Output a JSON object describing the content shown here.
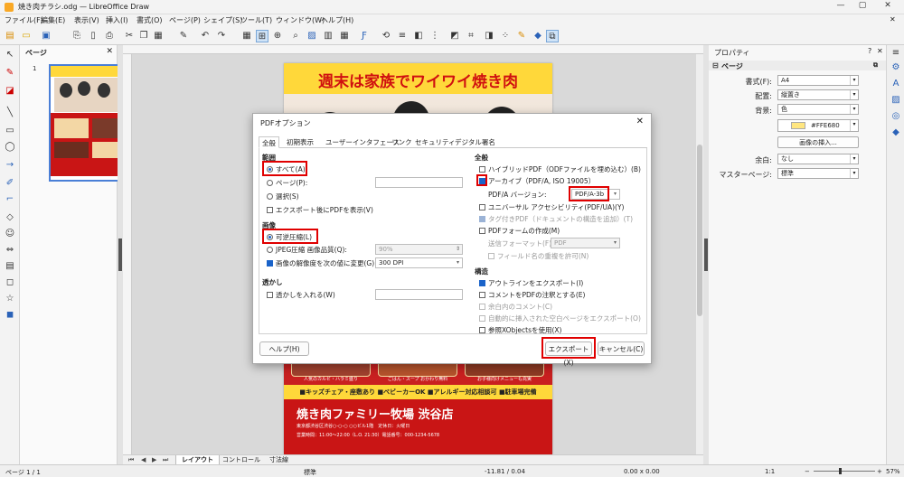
{
  "window": {
    "title": "焼き肉チラシ.odg — LibreOffice Draw"
  },
  "menu": [
    "ファイル(F)",
    "編集(E)",
    "表示(V)",
    "挿入(I)",
    "書式(O)",
    "ページ(P)",
    "シェイプ(S)",
    "ツール(T)",
    "ウィンドウ(W)",
    "ヘルプ(H)"
  ],
  "pages_panel": {
    "title": "ページ",
    "thumb_number": "1"
  },
  "flyer": {
    "headline": "週末は家族でワイワイ焼き肉",
    "food_captions": [
      "人気のカルビ・ハラミ盛り",
      "ごはん・スープ おかわり無料",
      "お子様向けメニューも充実"
    ],
    "features": "■キッズチェア・座敷あり ■ベビーカーOK ■アレルギー対応相談可 ■駐車場完備",
    "store": "焼き肉ファミリー牧場 渋谷店",
    "address": "東京都渋谷区渋谷○-○-○ ○○ビル1階　定休日：火曜日",
    "hours": "営業時間：11:00～22:00（L.O. 21:30）電話番号：000-1234-5678"
  },
  "page_tabs": [
    "レイアウト",
    "コントロール",
    "寸法線"
  ],
  "properties": {
    "title": "プロパティ",
    "section": "ページ",
    "format_label": "書式(F):",
    "format_value": "A4",
    "orientation_label": "配置:",
    "orientation_value": "縦置き",
    "background_label": "背景:",
    "background_value": "色",
    "color_value": "#FFE680",
    "insert_image": "画像の挿入...",
    "margin_label": "余白:",
    "margin_value": "なし",
    "master_label": "マスターページ:",
    "master_value": "標準"
  },
  "status": {
    "page": "ページ 1 / 1",
    "layout": "標準",
    "position": "-11.81 / 0.04",
    "size": "0.00 x 0.00",
    "scale": "1:1",
    "zoom": "57%"
  },
  "dialog": {
    "title": "PDFオプション",
    "tabs": [
      "全般",
      "初期表示",
      "ユーザーインタフェース",
      "リンク",
      "セキュリティ",
      "デジタル署名"
    ],
    "range": {
      "heading": "範囲",
      "all": "すべて(A)",
      "pages": "ページ(P):",
      "selection": "選択(S)",
      "view_after": "エクスポート後にPDFを表示(V)"
    },
    "images": {
      "heading": "画像",
      "lossless": "可逆圧縮(L)",
      "jpeg": "JPEG圧縮 画像品質(Q):",
      "jpeg_value": "90%",
      "reduce": "画像の解像度を次の値に変更(G):",
      "reduce_value": "300 DPI"
    },
    "watermark": {
      "heading": "透かし",
      "sign": "透かしを入れる(W)"
    },
    "general": {
      "heading": "全般",
      "hybrid": "ハイブリッドPDF（ODFファイルを埋め込む）(B)",
      "archive": "アーカイブ（PDF/A, ISO 19005）",
      "pdfa_label": "PDF/A バージョン:",
      "pdfa_value": "PDF/A-3b",
      "ua": "ユニバーサル アクセシビリティ(PDF/UA)(Y)",
      "tagged": "タグ付きPDF（ドキュメントの構造を追加）(T)",
      "form": "PDFフォームの作成(M)",
      "submit_label": "送信フォーマット(F):",
      "submit_value": "PDF",
      "dup_names": "フィールド名の重複を許可(N)"
    },
    "structure": {
      "heading": "構造",
      "outline": "アウトラインをエクスポート(I)",
      "comments_pdf": "コメントをPDFの注釈とする(E)",
      "margin_comments": "余白内のコメント(C)",
      "blank_pages": "自動的に挿入された空白ページをエクスポート(O)",
      "xobjects": "参照XObjectsを使用(X)"
    },
    "buttons": {
      "help": "ヘルプ(H)",
      "export": "エクスポート(X)",
      "cancel": "キャンセル(C)"
    }
  }
}
